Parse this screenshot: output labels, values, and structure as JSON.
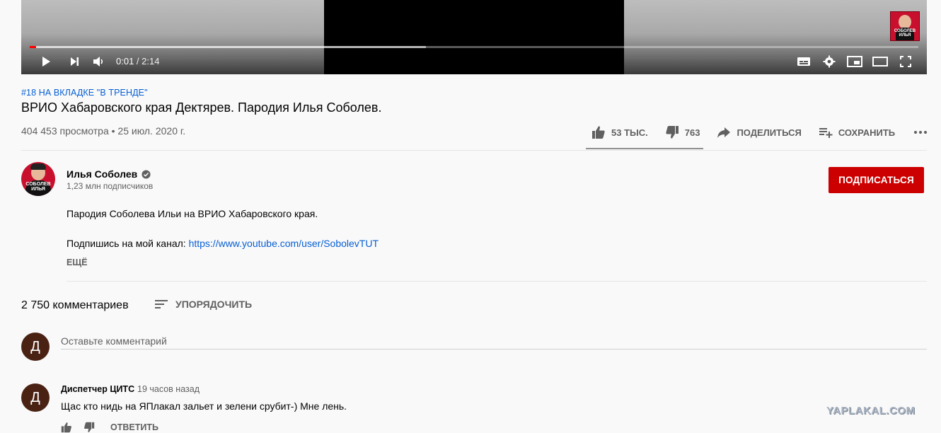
{
  "player": {
    "time_current": "0:01",
    "time_separator": " / ",
    "time_total": "2:14",
    "progress_played": 0.007,
    "progress_buffered": 0.446,
    "icons": [
      "play-icon",
      "next-icon",
      "volume-icon",
      "subtitles-icon",
      "settings-icon",
      "miniplayer-icon",
      "theater-icon",
      "fullscreen-icon"
    ],
    "thumb_text": "СОБОЛЕВ ИЛЬЯ"
  },
  "video": {
    "hashtag": "#18 НА ВКЛАДКЕ \"В ТРЕНДЕ\"",
    "title": "ВРИО Хабаровского края Дектярев. Пародия Илья Соболев.",
    "meta": "404 453 просмотра • 25 июл. 2020 г."
  },
  "actions": {
    "likes": "53 ТЫС.",
    "dislikes": "763",
    "share": "ПОДЕЛИТЬСЯ",
    "save": "СОХРАНИТЬ",
    "like_ratio": 0.986
  },
  "channel": {
    "name": "Илья Соболев",
    "subscribers": "1,23 млн подписчиков",
    "subscribe_label": "ПОДПИСАТЬСЯ",
    "avatar_text": "СОБОЛЕВ ИЛЬЯ"
  },
  "description": {
    "line1": "Пародия Соболева Ильи на ВРИО Хабаровского края.",
    "line2_prefix": "Подпишись на мой канал: ",
    "link": "https://www.youtube.com/user/SobolevTUT",
    "more": "ЕЩЁ"
  },
  "comments": {
    "count": "2 750 комментариев",
    "sort_label": "УПОРЯДОЧИТЬ",
    "input_placeholder": "Оставьте комментарий",
    "user_initial": "Д",
    "items": [
      {
        "initial": "Д",
        "author": "Диспетчер ЦИТС",
        "time": "19 часов назад",
        "text": "Щас кто нидь на ЯПлакал зальет и зелени срубит-) Мне лень.",
        "reply": "ОТВЕТИТЬ"
      }
    ]
  },
  "watermark": "YAPLAKAL.COM",
  "colors": {
    "accent_red": "#cc0000",
    "link_blue": "#065fd4",
    "progress_red": "#ff0000"
  }
}
